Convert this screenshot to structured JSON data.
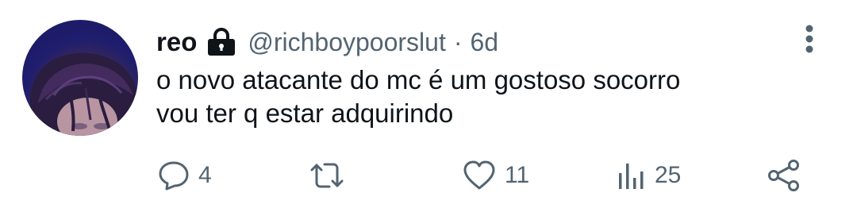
{
  "tweet": {
    "display_name": "reo",
    "handle": "@richboypoorslut",
    "separator": "·",
    "time": "6d",
    "text_lines": [
      "o novo atacante do mc é um gostoso socorro",
      "vou ter q estar adquirindo"
    ],
    "icons": {
      "protected": "lock-icon",
      "more": "more-vertical-icon"
    }
  },
  "actions": {
    "reply": {
      "icon": "reply-icon",
      "count": "4"
    },
    "retweet": {
      "icon": "retweet-icon",
      "count": ""
    },
    "like": {
      "icon": "heart-icon",
      "count": "11"
    },
    "views": {
      "icon": "views-icon",
      "count": "25"
    },
    "share": {
      "icon": "share-icon"
    }
  },
  "colors": {
    "text": "#0f1419",
    "secondary": "#536471",
    "background": "#ffffff"
  }
}
